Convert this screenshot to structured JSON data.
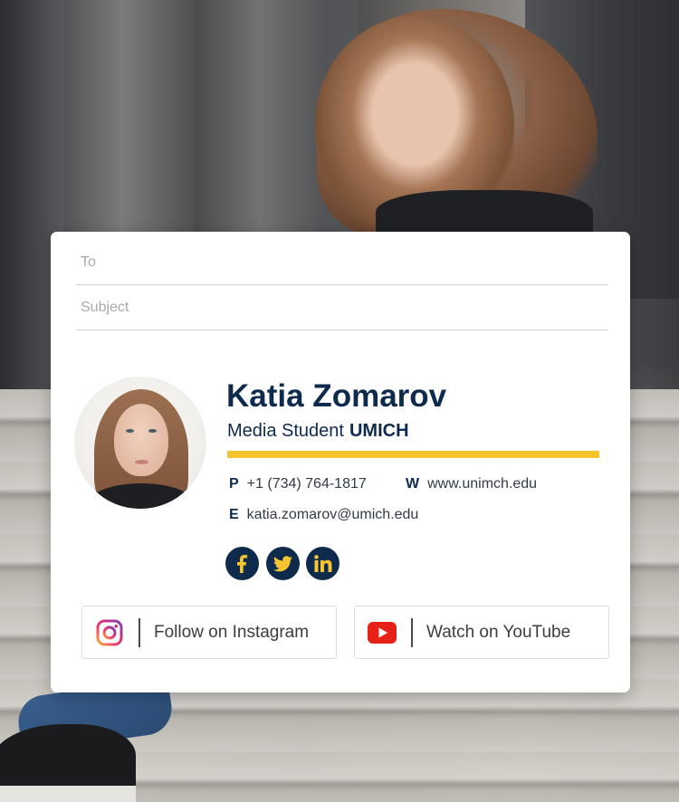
{
  "compose": {
    "to_label": "To",
    "subject_label": "Subject"
  },
  "signature": {
    "name": "Katia Zomarov",
    "title": "Media Student",
    "organization": "UMICH",
    "accent_color": "#f6c42f",
    "brand_color": "#0e2a4d",
    "contacts": {
      "phone_key": "P",
      "phone": "+1 (734) 764-1817",
      "web_key": "W",
      "web": "www.unimch.edu",
      "email_key": "E",
      "email": "katia.zomarov@umich.edu"
    },
    "social_icons": [
      "facebook-icon",
      "twitter-icon",
      "linkedin-icon"
    ]
  },
  "buttons": {
    "instagram_label": "Follow on Instagram",
    "youtube_label": "Watch on YouTube"
  }
}
